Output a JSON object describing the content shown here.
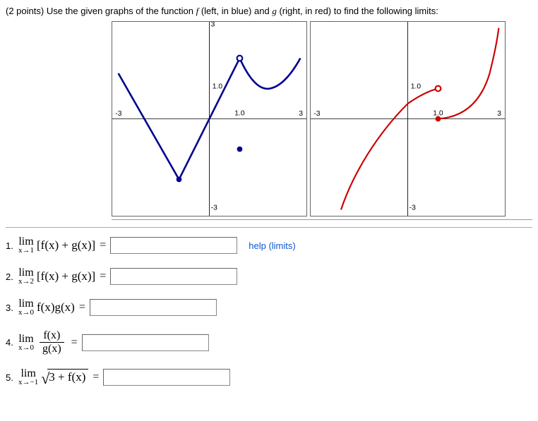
{
  "header": {
    "points": "(2 points)",
    "lead": "Use the given graphs of the function",
    "f": "f",
    "mid1": "(left, in blue) and",
    "g": "g",
    "mid2": "(right, in red) to find the following limits:"
  },
  "help_label": "help (limits)",
  "questions": [
    {
      "num": "1.",
      "lim_top": "lim",
      "lim_bot": "x→1",
      "body": "[f(x) + g(x)]"
    },
    {
      "num": "2.",
      "lim_top": "lim",
      "lim_bot": "x→2",
      "body": "[f(x) + g(x)]"
    },
    {
      "num": "3.",
      "lim_top": "lim",
      "lim_bot": "x→0",
      "body": "f(x)g(x)"
    },
    {
      "num": "4.",
      "lim_top": "lim",
      "lim_bot": "x→0",
      "frac_top": "f(x)",
      "frac_bot": "g(x)"
    },
    {
      "num": "5.",
      "lim_top": "lim",
      "lim_bot": "x→−1",
      "radicand": "3 + f(x)"
    }
  ],
  "chart_data": [
    {
      "type": "line",
      "title": "f",
      "xlabel": "",
      "ylabel": "",
      "xlim": [
        -3,
        3
      ],
      "ylim": [
        -3,
        3
      ],
      "ticks": {
        "x_label": "1.0",
        "y_label": "1.0",
        "neg_y": "-3"
      },
      "series": [
        {
          "name": "f_main_piecewise",
          "x": [
            -3,
            -1,
            1,
            2,
            3
          ],
          "y": [
            1.5,
            -2,
            2,
            1,
            2
          ]
        }
      ],
      "open_points": [
        {
          "x": 1,
          "y": 2
        }
      ],
      "closed_points": [
        {
          "x": -1,
          "y": -2
        },
        {
          "x": 1,
          "y": -1
        }
      ],
      "color": "#000080"
    },
    {
      "type": "line",
      "title": "g",
      "xlabel": "",
      "ylabel": "",
      "xlim": [
        -3,
        3
      ],
      "ylim": [
        -3,
        3
      ],
      "ticks": {
        "x_label": "1.0",
        "y_label": "1.0",
        "neg_y": "-3"
      },
      "series": [
        {
          "name": "g_left",
          "x": [
            -2.2,
            -2,
            -1,
            0,
            1
          ],
          "y": [
            -3,
            -2.5,
            -0.5,
            0.5,
            1
          ]
        },
        {
          "name": "g_right",
          "x": [
            1,
            2,
            2.5,
            2.8,
            3
          ],
          "y": [
            0,
            0.3,
            1,
            2,
            3
          ]
        }
      ],
      "open_points": [
        {
          "x": 1,
          "y": 1
        }
      ],
      "closed_points": [
        {
          "x": 1,
          "y": 0
        }
      ],
      "color": "#cc0000"
    }
  ]
}
